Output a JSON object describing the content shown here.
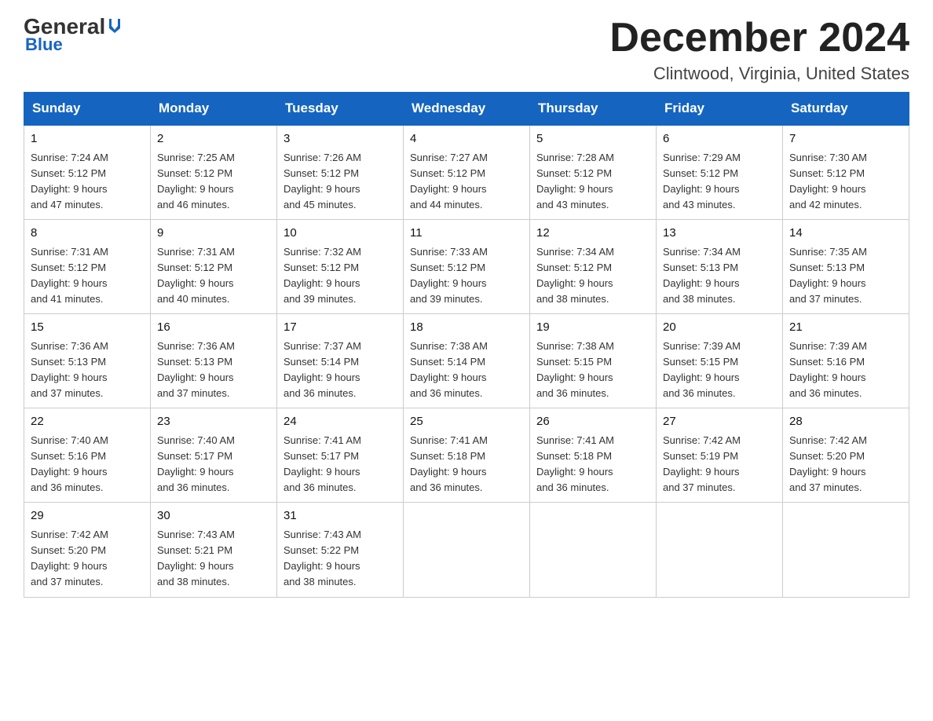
{
  "logo": {
    "general": "General",
    "blue": "Blue"
  },
  "header": {
    "month": "December 2024",
    "location": "Clintwood, Virginia, United States"
  },
  "days_of_week": [
    "Sunday",
    "Monday",
    "Tuesday",
    "Wednesday",
    "Thursday",
    "Friday",
    "Saturday"
  ],
  "weeks": [
    [
      {
        "day": "1",
        "sunrise": "7:24 AM",
        "sunset": "5:12 PM",
        "daylight": "9 hours and 47 minutes."
      },
      {
        "day": "2",
        "sunrise": "7:25 AM",
        "sunset": "5:12 PM",
        "daylight": "9 hours and 46 minutes."
      },
      {
        "day": "3",
        "sunrise": "7:26 AM",
        "sunset": "5:12 PM",
        "daylight": "9 hours and 45 minutes."
      },
      {
        "day": "4",
        "sunrise": "7:27 AM",
        "sunset": "5:12 PM",
        "daylight": "9 hours and 44 minutes."
      },
      {
        "day": "5",
        "sunrise": "7:28 AM",
        "sunset": "5:12 PM",
        "daylight": "9 hours and 43 minutes."
      },
      {
        "day": "6",
        "sunrise": "7:29 AM",
        "sunset": "5:12 PM",
        "daylight": "9 hours and 43 minutes."
      },
      {
        "day": "7",
        "sunrise": "7:30 AM",
        "sunset": "5:12 PM",
        "daylight": "9 hours and 42 minutes."
      }
    ],
    [
      {
        "day": "8",
        "sunrise": "7:31 AM",
        "sunset": "5:12 PM",
        "daylight": "9 hours and 41 minutes."
      },
      {
        "day": "9",
        "sunrise": "7:31 AM",
        "sunset": "5:12 PM",
        "daylight": "9 hours and 40 minutes."
      },
      {
        "day": "10",
        "sunrise": "7:32 AM",
        "sunset": "5:12 PM",
        "daylight": "9 hours and 39 minutes."
      },
      {
        "day": "11",
        "sunrise": "7:33 AM",
        "sunset": "5:12 PM",
        "daylight": "9 hours and 39 minutes."
      },
      {
        "day": "12",
        "sunrise": "7:34 AM",
        "sunset": "5:12 PM",
        "daylight": "9 hours and 38 minutes."
      },
      {
        "day": "13",
        "sunrise": "7:34 AM",
        "sunset": "5:13 PM",
        "daylight": "9 hours and 38 minutes."
      },
      {
        "day": "14",
        "sunrise": "7:35 AM",
        "sunset": "5:13 PM",
        "daylight": "9 hours and 37 minutes."
      }
    ],
    [
      {
        "day": "15",
        "sunrise": "7:36 AM",
        "sunset": "5:13 PM",
        "daylight": "9 hours and 37 minutes."
      },
      {
        "day": "16",
        "sunrise": "7:36 AM",
        "sunset": "5:13 PM",
        "daylight": "9 hours and 37 minutes."
      },
      {
        "day": "17",
        "sunrise": "7:37 AM",
        "sunset": "5:14 PM",
        "daylight": "9 hours and 36 minutes."
      },
      {
        "day": "18",
        "sunrise": "7:38 AM",
        "sunset": "5:14 PM",
        "daylight": "9 hours and 36 minutes."
      },
      {
        "day": "19",
        "sunrise": "7:38 AM",
        "sunset": "5:15 PM",
        "daylight": "9 hours and 36 minutes."
      },
      {
        "day": "20",
        "sunrise": "7:39 AM",
        "sunset": "5:15 PM",
        "daylight": "9 hours and 36 minutes."
      },
      {
        "day": "21",
        "sunrise": "7:39 AM",
        "sunset": "5:16 PM",
        "daylight": "9 hours and 36 minutes."
      }
    ],
    [
      {
        "day": "22",
        "sunrise": "7:40 AM",
        "sunset": "5:16 PM",
        "daylight": "9 hours and 36 minutes."
      },
      {
        "day": "23",
        "sunrise": "7:40 AM",
        "sunset": "5:17 PM",
        "daylight": "9 hours and 36 minutes."
      },
      {
        "day": "24",
        "sunrise": "7:41 AM",
        "sunset": "5:17 PM",
        "daylight": "9 hours and 36 minutes."
      },
      {
        "day": "25",
        "sunrise": "7:41 AM",
        "sunset": "5:18 PM",
        "daylight": "9 hours and 36 minutes."
      },
      {
        "day": "26",
        "sunrise": "7:41 AM",
        "sunset": "5:18 PM",
        "daylight": "9 hours and 36 minutes."
      },
      {
        "day": "27",
        "sunrise": "7:42 AM",
        "sunset": "5:19 PM",
        "daylight": "9 hours and 37 minutes."
      },
      {
        "day": "28",
        "sunrise": "7:42 AM",
        "sunset": "5:20 PM",
        "daylight": "9 hours and 37 minutes."
      }
    ],
    [
      {
        "day": "29",
        "sunrise": "7:42 AM",
        "sunset": "5:20 PM",
        "daylight": "9 hours and 37 minutes."
      },
      {
        "day": "30",
        "sunrise": "7:43 AM",
        "sunset": "5:21 PM",
        "daylight": "9 hours and 38 minutes."
      },
      {
        "day": "31",
        "sunrise": "7:43 AM",
        "sunset": "5:22 PM",
        "daylight": "9 hours and 38 minutes."
      },
      null,
      null,
      null,
      null
    ]
  ],
  "labels": {
    "sunrise": "Sunrise:",
    "sunset": "Sunset:",
    "daylight": "Daylight:"
  }
}
